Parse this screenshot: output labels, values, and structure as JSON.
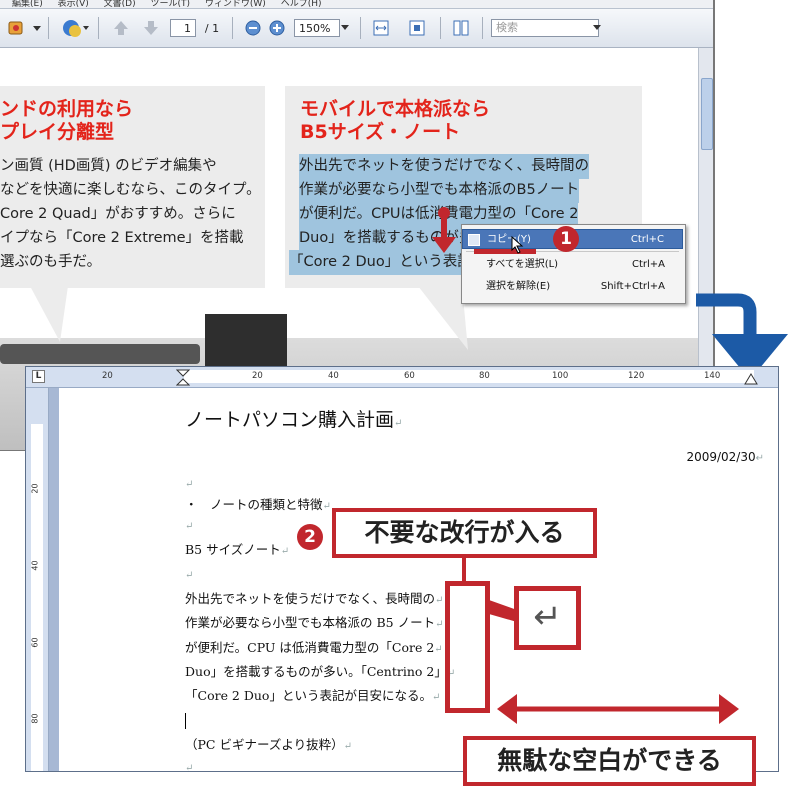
{
  "reader": {
    "menubar": [
      "編集(E)",
      "表示(V)",
      "文書(D)",
      "ツール(T)",
      "ウィンドウ(W)",
      "ヘルプ(H)"
    ],
    "page_current": "1",
    "page_total": "/ 1",
    "zoom": "150%",
    "search_placeholder": "検索"
  },
  "pdf": {
    "left_panel": {
      "title_1": "ンドの利用なら",
      "title_2": "プレイ分離型",
      "lines": [
        "ン画質 (HD画質) のビデオ編集や",
        "などを快適に楽しむなら、このタイプ。",
        "Core 2 Quad」がおすすめ。さらに",
        "イプなら「Core 2 Extreme」を搭載",
        "選ぶのも手だ。"
      ]
    },
    "right_panel": {
      "title_1": "モバイルで本格派なら",
      "title_2": "B5サイズ・ノート",
      "lines": [
        "外出先でネットを使うだけでなく、長時間の",
        "作業が必要なら小型でも本格派のB5ノート",
        "が便利だ。CPUは低消費電力型の「Core 2",
        "Duo」を搭載するものが多い。「Centrino 2」",
        "「Core 2 Duo」という表記が目安になる。"
      ]
    }
  },
  "context_menu": {
    "items": [
      {
        "label": "コピー(Y)",
        "shortcut": "Ctrl+C"
      },
      {
        "label": "すべてを選択(L)",
        "shortcut": "Ctrl+A"
      },
      {
        "label": "選択を解除(E)",
        "shortcut": "Shift+Ctrl+A"
      }
    ]
  },
  "word": {
    "ruler_h": [
      "20",
      "20",
      "40",
      "60",
      "80",
      "100",
      "120",
      "140"
    ],
    "ruler_v": [
      "20",
      "40",
      "60",
      "80"
    ],
    "ruler_corner": "L",
    "doc_title": "ノートパソコン購入計画",
    "date": "2009/02/30",
    "heading": "・　ノートの種類と特徴",
    "subheading": "B5 サイズノート",
    "body_lines": [
      "外出先でネットを使うだけでなく、長時間の",
      "作業が必要なら小型でも本格派の B5 ノート",
      "が便利だ。CPU は低消費電力型の「Core 2",
      "Duo」を搭載するものが多い。「Centrino 2」",
      "「Core 2 Duo」という表記が目安になる。"
    ],
    "source": "（PC ビギナーズより抜粋）"
  },
  "annotations": {
    "step1": "1",
    "step2": "2",
    "callout_newline": "不要な改行が入る",
    "callout_space": "無駄な空白ができる",
    "return_glyph": "↵",
    "color_red": "#c1272d",
    "color_blue": "#1c5aa6"
  }
}
